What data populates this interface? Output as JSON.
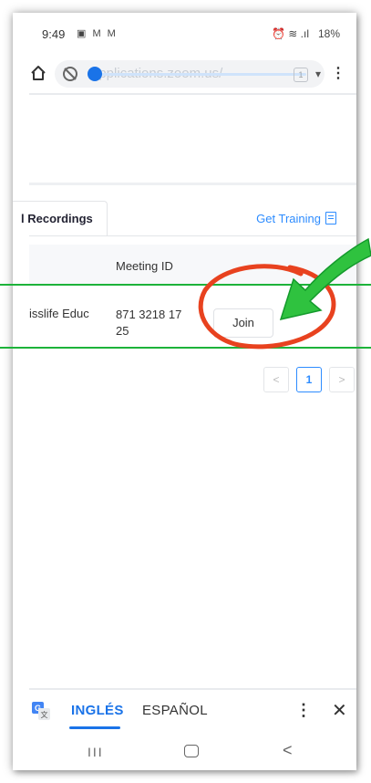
{
  "status_bar": {
    "time": "9:49",
    "left_icons": "▣ M M",
    "right_icons": "⏰ ≋ .ıl",
    "battery": "18%"
  },
  "browser": {
    "url": "applications.zoom.us/",
    "tab_count": "1"
  },
  "tabs": {
    "recordings": "l Recordings",
    "get_training": "Get Training"
  },
  "table": {
    "headers": {
      "meeting_id": "Meeting ID"
    },
    "rows": [
      {
        "topic": "isslife Educ",
        "meeting_id": "871 3218 17 25",
        "action": "Join"
      }
    ]
  },
  "pagination": {
    "prev": "<",
    "current": "1",
    "next": ">"
  },
  "translate": {
    "source_lang": "INGLÉS",
    "target_lang": "ESPAÑOL",
    "menu": "⋮",
    "close": "✕"
  },
  "nav": {
    "recent": "III",
    "back": "<"
  },
  "colors": {
    "accent_blue": "#1a73e8",
    "zoom_blue": "#2d8cff",
    "annotation_red": "#e8421f",
    "annotation_green": "#1db33a"
  }
}
